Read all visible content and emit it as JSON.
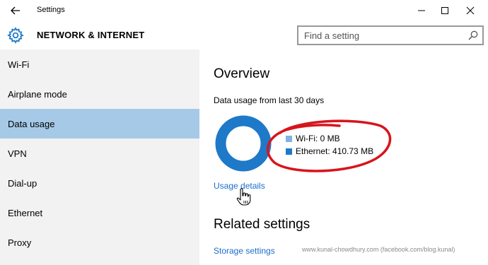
{
  "window": {
    "title": "Settings"
  },
  "header": {
    "title": "NETWORK & INTERNET"
  },
  "search": {
    "placeholder": "Find a setting"
  },
  "sidebar": {
    "items": [
      {
        "label": "Wi-Fi",
        "selected": false
      },
      {
        "label": "Airplane mode",
        "selected": false
      },
      {
        "label": "Data usage",
        "selected": true
      },
      {
        "label": "VPN",
        "selected": false
      },
      {
        "label": "Dial-up",
        "selected": false
      },
      {
        "label": "Ethernet",
        "selected": false
      },
      {
        "label": "Proxy",
        "selected": false
      }
    ]
  },
  "main": {
    "overview_title": "Overview",
    "usage_caption": "Data usage from last 30 days",
    "legend": [
      {
        "label": "Wi-Fi: 0 MB",
        "color": "#7fb3e3"
      },
      {
        "label": "Ethernet: 410.73 MB",
        "color": "#1e79c8"
      }
    ],
    "usage_details_link": "Usage details",
    "related_title": "Related settings",
    "storage_link": "Storage settings"
  },
  "watermark": "www.kunal-chowdhury.com (facebook.com/blog.kunal)",
  "colors": {
    "accent": "#1e79c8",
    "link": "#1a6fc9",
    "selected_nav": "#a6c9e8",
    "sidebar_bg": "#f2f2f2",
    "annotation": "#d8141c"
  }
}
